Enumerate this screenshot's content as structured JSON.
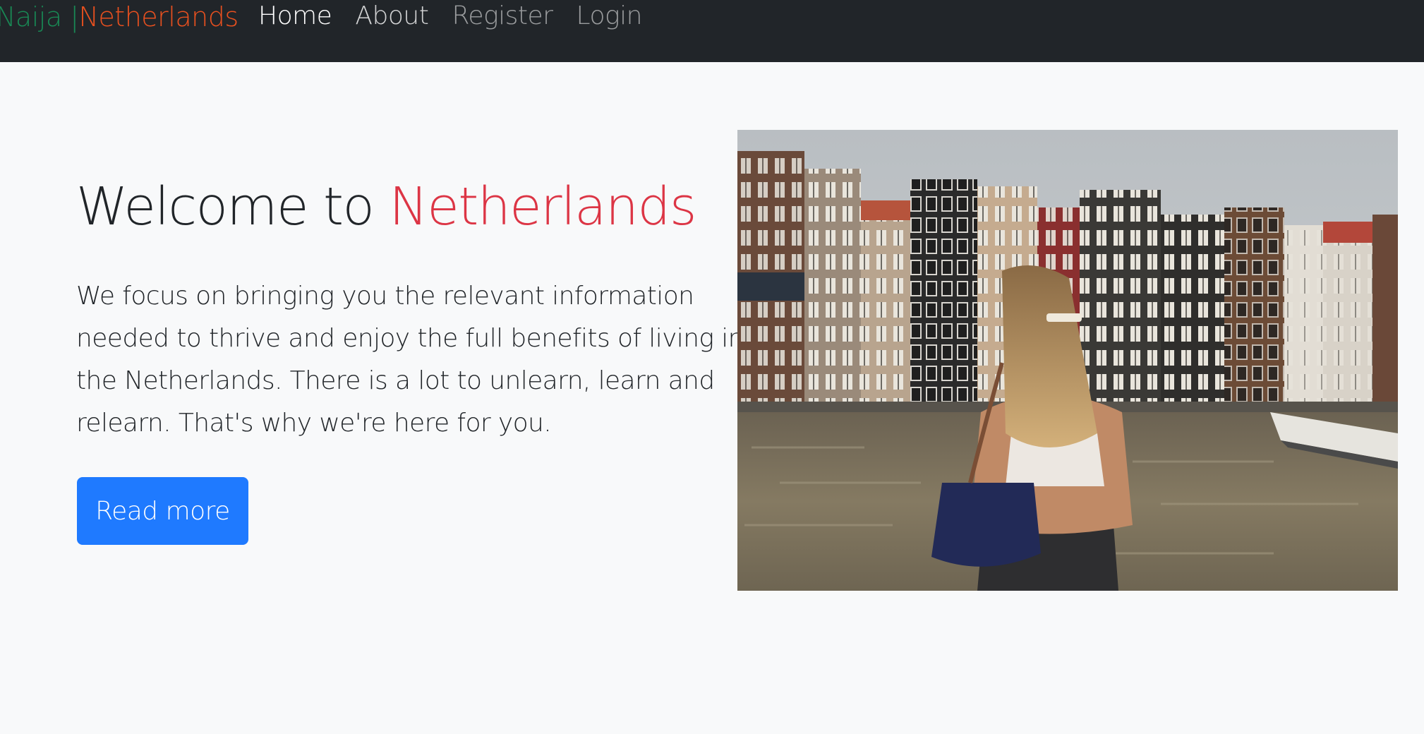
{
  "brand": {
    "part1": "Naija |",
    "part2": "Netherlands"
  },
  "nav": {
    "items": [
      "Home",
      "About",
      "Register",
      "Login"
    ]
  },
  "hero": {
    "title_prefix": "Welcome to",
    "title_accent": "Netherlands",
    "description": "We focus on bringing you the relevant information needed to thrive and enjoy the full benefits of living in the Netherlands. There is a lot to unlearn, learn and relearn. That's why we're here for you.",
    "button_label": "Read more"
  },
  "colors": {
    "navbar": "#212529",
    "brand_green": "#198754",
    "brand_orange": "#e8501f",
    "accent_red": "#dc3545",
    "button_blue": "#1f7aff",
    "page_bg": "#f8f9fa"
  },
  "image": {
    "alt": "Amsterdam canal houses"
  }
}
